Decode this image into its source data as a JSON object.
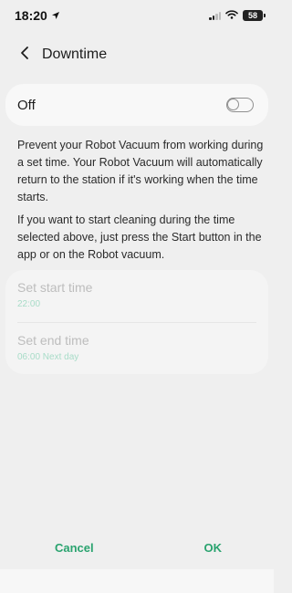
{
  "status_bar": {
    "time": "18:20",
    "battery": "58",
    "location_icon": "location-arrow-icon",
    "signal_icon": "cellular-signal-icon",
    "wifi_icon": "wifi-icon"
  },
  "header": {
    "title": "Downtime",
    "back_icon": "chevron-left-icon"
  },
  "toggle": {
    "label": "Off",
    "state": "off"
  },
  "description": {
    "paragraph_1": "Prevent your Robot Vacuum from working during a set time. Your Robot Vacuum will automatically return to the station if it's working when the time starts.",
    "paragraph_2": "If you want to start cleaning during the time selected above, just press the Start button in the app or on the Robot vacuum."
  },
  "schedule": {
    "start": {
      "label": "Set start time",
      "value": "22:00"
    },
    "end": {
      "label": "Set end time",
      "value": "06:00 Next day"
    }
  },
  "actions": {
    "cancel_label": "Cancel",
    "ok_label": "OK"
  },
  "colors": {
    "accent": "#2aa36f",
    "disabled_value": "#a8dcc8",
    "background": "#efefef",
    "card": "#f8f8f8"
  }
}
